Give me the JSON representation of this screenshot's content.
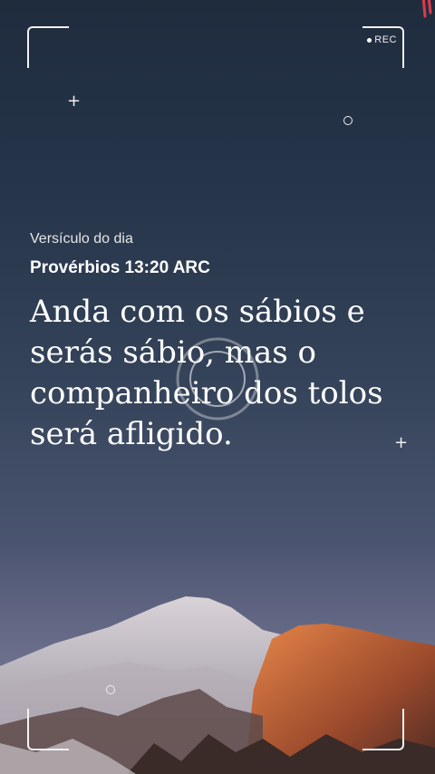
{
  "overlay": {
    "rec_label": "REC"
  },
  "verse_card": {
    "subtitle": "Versículo do dia",
    "reference": "Provérbios 13:20 ARC",
    "text": "Anda com os sábios e serás sábio, mas o companheiro dos tolos será afligido."
  },
  "colors": {
    "text": "#ffffff",
    "sky_top": "#1f2c3e",
    "sky_bottom": "#7b7b96",
    "rec_accent": "#e03a4a"
  },
  "icons": [
    "plus-sparkle-icon",
    "ring-sparkle-icon",
    "camera-focus-icon",
    "rec-dot-icon"
  ]
}
